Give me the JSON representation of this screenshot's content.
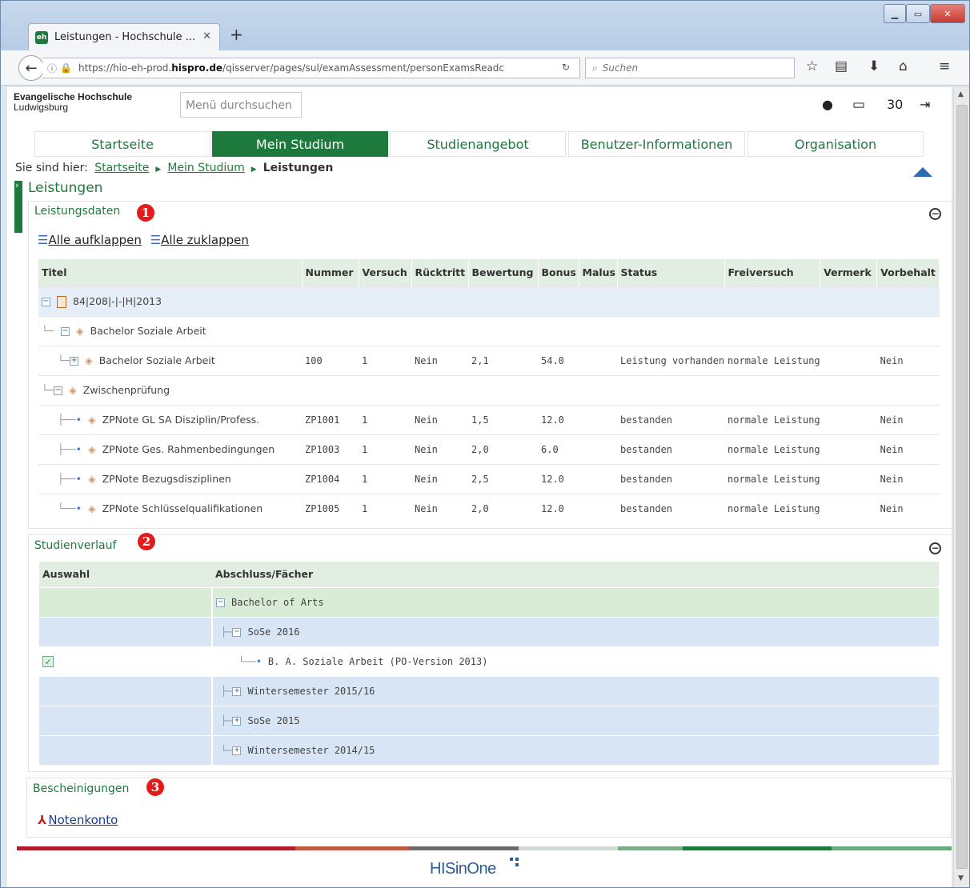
{
  "browser": {
    "tab_title": "Leistungen - Hochschule ...",
    "favicon_text": "eh",
    "url_prefix": "https://hio-eh-prod.",
    "url_host": "hispro.de",
    "url_path": "/qisserver/pages/sul/examAssessment/personExamsReadc",
    "search_placeholder": "Suchen"
  },
  "header": {
    "logo_line1": "Evangelische Hochschule",
    "logo_line2": "Ludwigsburg",
    "menu_search_placeholder": "Menü durchsuchen",
    "counter": "30"
  },
  "nav": [
    "Startseite",
    "Mein Studium",
    "Studienangebot",
    "Benutzer-Informationen",
    "Organisation"
  ],
  "breadcrumb": {
    "label": "Sie sind hier:",
    "items": [
      "Startseite",
      "Mein Studium"
    ],
    "current": "Leistungen"
  },
  "page_title": "Leistungen",
  "leistungsdaten": {
    "title": "Leistungsdaten",
    "badge": "1",
    "expand_all": "Alle aufklappen",
    "collapse_all": "Alle zuklappen",
    "columns": [
      "Titel",
      "Nummer",
      "Versuch",
      "Rücktritt",
      "Bewertung",
      "Bonus",
      "Malus",
      "Status",
      "Freiversuch",
      "Vermerk",
      "Vorbehalt"
    ],
    "rows": [
      {
        "title": "84|208|-|-|H|2013",
        "cells": [
          "",
          "",
          "",
          "",
          "",
          "",
          "",
          "",
          "",
          ""
        ]
      },
      {
        "title": "Bachelor Soziale Arbeit",
        "cells": [
          "",
          "",
          "",
          "",
          "",
          "",
          "",
          "",
          "",
          ""
        ]
      },
      {
        "title": "Bachelor Soziale Arbeit",
        "cells": [
          "100",
          "1",
          "Nein",
          "2,1",
          "54.0",
          "",
          "Leistung vorhanden",
          "normale Leistung",
          "",
          "Nein"
        ]
      },
      {
        "title": "Zwischenprüfung",
        "cells": [
          "",
          "",
          "",
          "",
          "",
          "",
          "",
          "",
          "",
          ""
        ]
      },
      {
        "title": "ZPNote GL SA Disziplin/Profess.",
        "cells": [
          "ZP1001",
          "1",
          "Nein",
          "1,5",
          "12.0",
          "",
          "bestanden",
          "normale Leistung",
          "",
          "Nein"
        ]
      },
      {
        "title": "ZPNote Ges. Rahmenbedingungen",
        "cells": [
          "ZP1003",
          "1",
          "Nein",
          "2,0",
          "6.0",
          "",
          "bestanden",
          "normale Leistung",
          "",
          "Nein"
        ]
      },
      {
        "title": "ZPNote Bezugsdisziplinen",
        "cells": [
          "ZP1004",
          "1",
          "Nein",
          "2,5",
          "12.0",
          "",
          "bestanden",
          "normale Leistung",
          "",
          "Nein"
        ]
      },
      {
        "title": "ZPNote Schlüsselqualifikationen",
        "cells": [
          "ZP1005",
          "1",
          "Nein",
          "2,0",
          "12.0",
          "",
          "bestanden",
          "normale Leistung",
          "",
          "Nein"
        ]
      }
    ]
  },
  "studienverlauf": {
    "title": "Studienverlauf",
    "badge": "2",
    "columns": [
      "Auswahl",
      "Abschluss/Fächer"
    ],
    "rows": [
      "Bachelor of Arts",
      "SoSe 2016",
      "B. A. Soziale Arbeit (PO-Version 2013)",
      "Wintersemester 2015/16",
      "SoSe 2015",
      "Wintersemester 2014/15"
    ]
  },
  "bescheinigungen": {
    "title": "Bescheinigungen",
    "badge": "3",
    "link": "Notenkonto"
  },
  "footer": {
    "brand": "HISinOne"
  }
}
